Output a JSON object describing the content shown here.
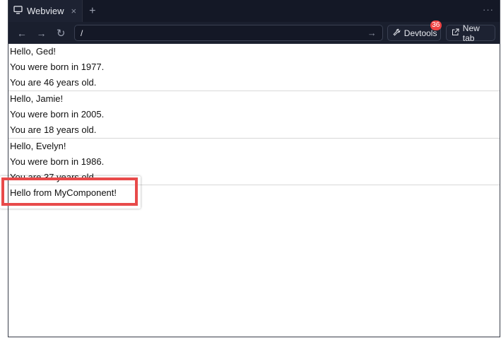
{
  "tabbar": {
    "tab_title": "Webview",
    "tab_close_glyph": "×",
    "add_tab_glyph": "+",
    "more_glyph": "···"
  },
  "toolbar": {
    "back_glyph": "←",
    "forward_glyph": "→",
    "reload_glyph": "↻",
    "url": "/",
    "go_glyph": "→",
    "devtools_label": "Devtools",
    "devtools_badge": "36",
    "newtab_label": "New tab"
  },
  "people": [
    {
      "greeting": "Hello, Ged!",
      "born": "You were born in 1977.",
      "age": "You are 46 years old."
    },
    {
      "greeting": "Hello, Jamie!",
      "born": "You were born in 2005.",
      "age": "You are 18 years old."
    },
    {
      "greeting": "Hello, Evelyn!",
      "born": "You were born in 1986.",
      "age": "You are 37 years old."
    }
  ],
  "my_component": {
    "text": "Hello from MyComponent!"
  },
  "colors": {
    "highlight": "#e84a4a",
    "badge": "#ef4444",
    "chrome_bg": "#141826"
  }
}
